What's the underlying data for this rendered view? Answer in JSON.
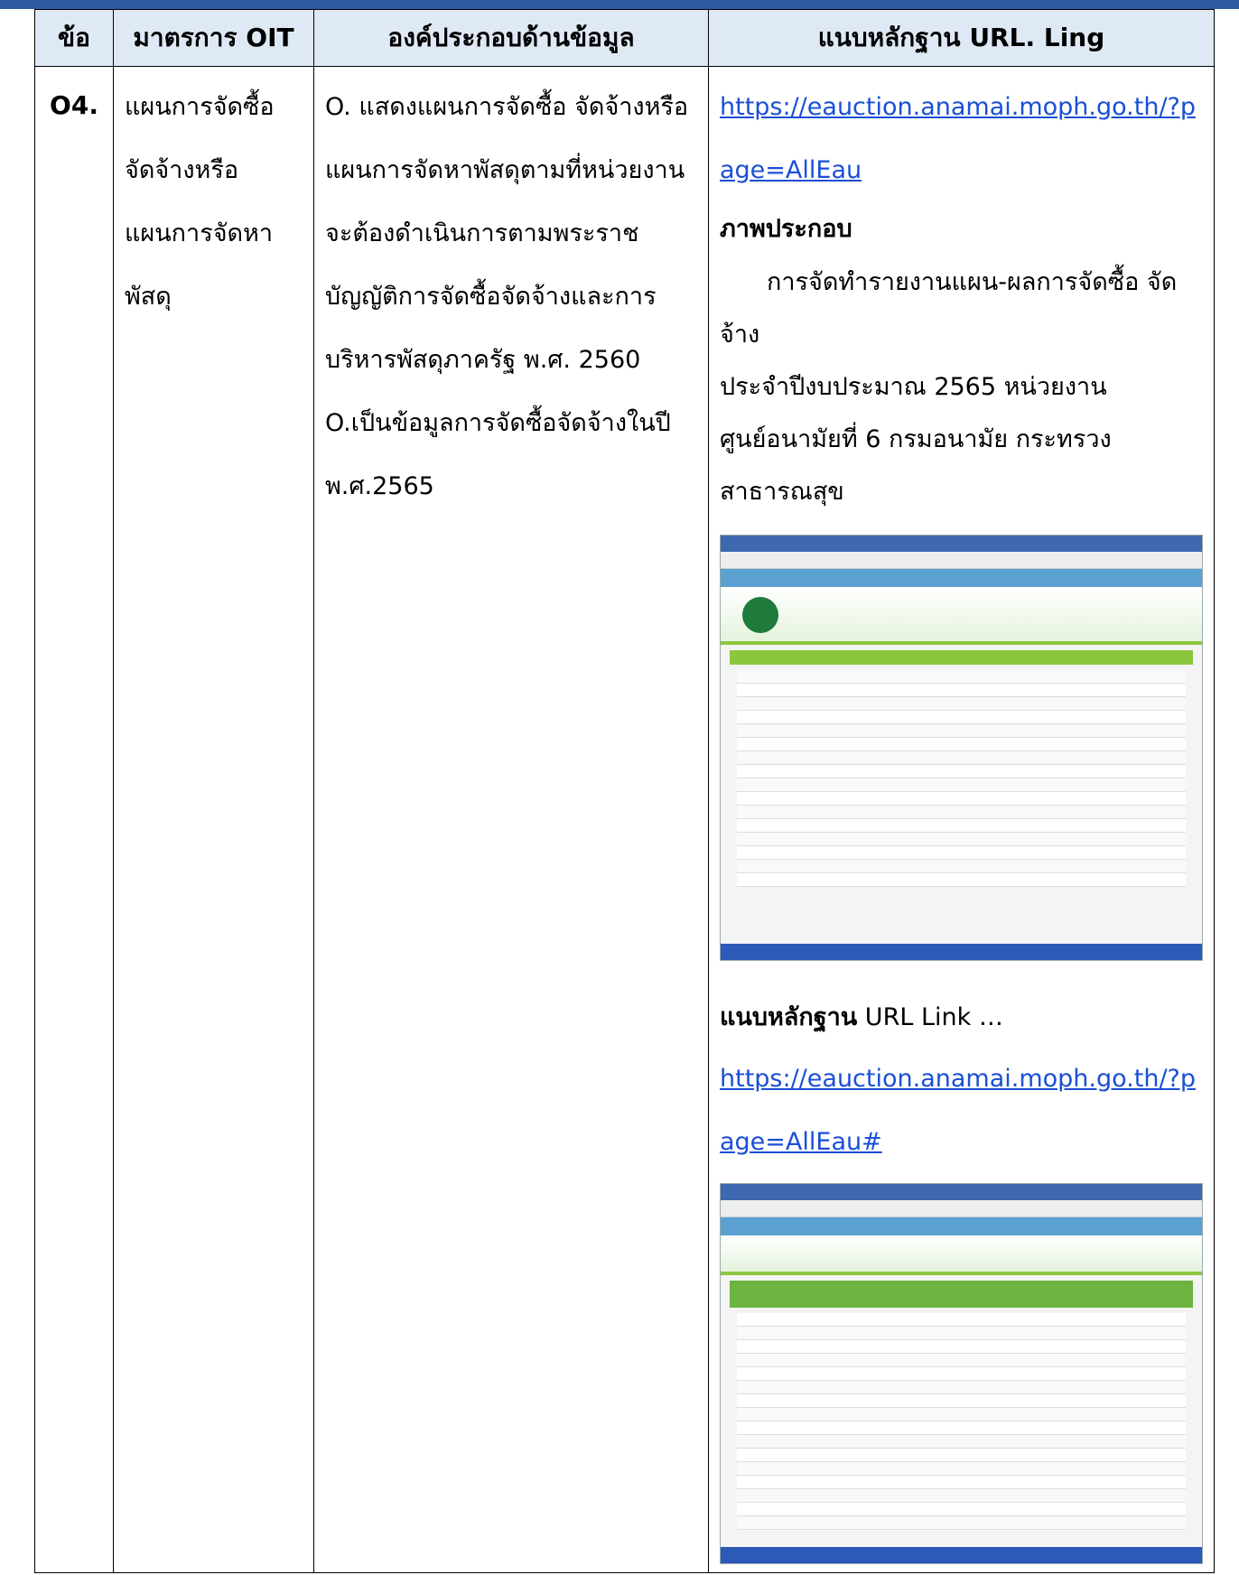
{
  "header": {
    "col1": "ข้อ",
    "col2": "มาตรการ OIT",
    "col3": "องค์ประกอบด้านข้อมูล",
    "col4": "แนบหลักฐาน URL. Ling"
  },
  "row": {
    "number": "O4.",
    "measure": "แผนการจัดซื้อจัดจ้างหรือแผนการจัดหาพัสดุ",
    "component_1": "O. แสดงแผนการจัดซื้อ จัดจ้างหรือแผนการจัดหาพัสดุตามที่หน่วยงานจะต้องดำเนินการตามพระราชบัญญัติการจัดซื้อจัดจ้างและการบริหารพัสดุภาครัฐ พ.ศ. 2560",
    "component_2": "O.เป็นข้อมูลการจัดซื้อจัดจ้างในปี พ.ศ.2565",
    "link1": "https://eauction.anamai.moph.go.th/?page=AllEau",
    "illustration_label": "ภาพประกอบ",
    "illustration_text_1": "การจัดทำรายงานแผน-ผลการจัดซื้อ จัดจ้าง",
    "illustration_text_2": "ประจำปีงบประมาณ 2565 หน่วยงาน",
    "illustration_text_3": "ศูนย์อนามัยที่ 6 กรมอนามัย กระทรวงสาธารณสุข",
    "evidence_label": "แนบหลักฐาน",
    "evidence_suffix": " URL Link …",
    "link2": "https://eauction.anamai.moph.go.th/?page=AllEau#"
  }
}
